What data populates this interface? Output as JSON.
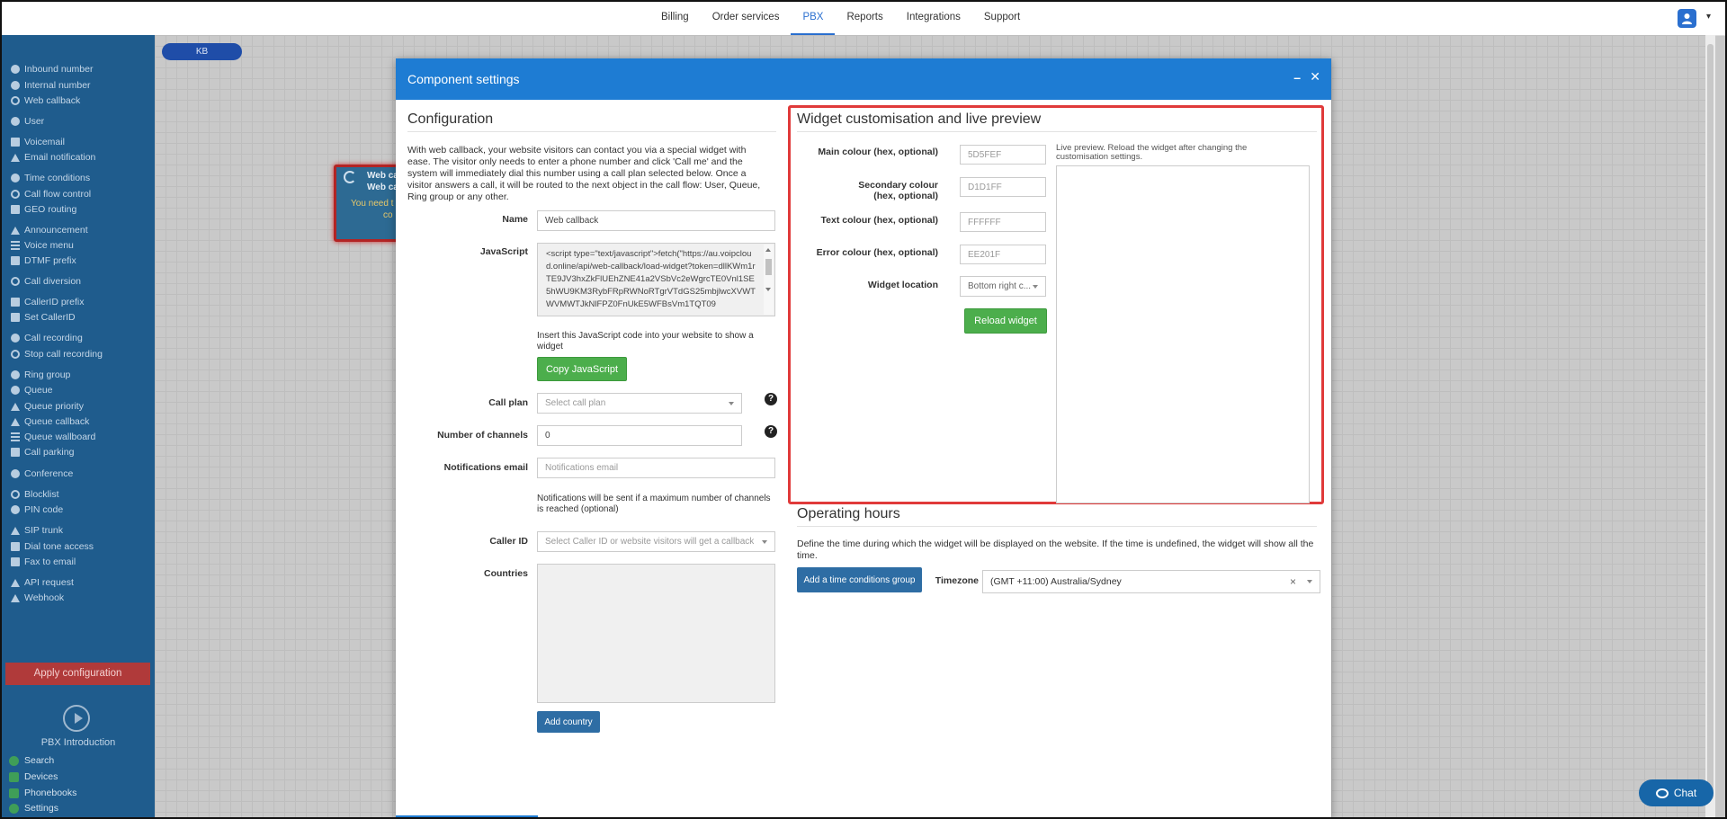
{
  "nav": {
    "tabs": [
      {
        "label": "Billing"
      },
      {
        "label": "Order services"
      },
      {
        "label": "PBX"
      },
      {
        "label": "Reports"
      },
      {
        "label": "Integrations"
      },
      {
        "label": "Support"
      }
    ],
    "active_tab": "PBX"
  },
  "sidebar": {
    "items": [
      {
        "label": "Inbound number",
        "icon": "circle-icon"
      },
      {
        "label": "Internal number",
        "icon": "pin-icon"
      },
      {
        "label": "Web callback",
        "icon": "undo-icon"
      },
      {
        "label": "User",
        "icon": "user-icon"
      },
      {
        "label": "Voicemail",
        "icon": "envelope-icon"
      },
      {
        "label": "Email notification",
        "icon": "bell-icon"
      },
      {
        "label": "Time conditions",
        "icon": "clock-icon"
      },
      {
        "label": "Call flow control",
        "icon": "toggle-icon"
      },
      {
        "label": "GEO routing",
        "icon": "sitemap-icon"
      },
      {
        "label": "Announcement",
        "icon": "megaphone-icon"
      },
      {
        "label": "Voice menu",
        "icon": "menu-icon"
      },
      {
        "label": "DTMF prefix",
        "icon": "code-icon"
      },
      {
        "label": "Call diversion",
        "icon": "redo-icon"
      },
      {
        "label": "CallerID prefix",
        "icon": "id-icon"
      },
      {
        "label": "Set CallerID",
        "icon": "id-card-icon"
      },
      {
        "label": "Call recording",
        "icon": "microphone-icon"
      },
      {
        "label": "Stop call recording",
        "icon": "microphone-slash-icon"
      },
      {
        "label": "Ring group",
        "icon": "users-icon"
      },
      {
        "label": "Queue",
        "icon": "queue-icon"
      },
      {
        "label": "Queue priority",
        "icon": "arrow-up-icon"
      },
      {
        "label": "Queue callback",
        "icon": "reply-icon"
      },
      {
        "label": "Queue wallboard",
        "icon": "dashboard-icon"
      },
      {
        "label": "Call parking",
        "icon": "parking-icon"
      },
      {
        "label": "Conference",
        "icon": "comments-icon"
      },
      {
        "label": "Blocklist",
        "icon": "ban-icon"
      },
      {
        "label": "PIN code",
        "icon": "key-icon"
      },
      {
        "label": "SIP trunk",
        "icon": "plug-icon"
      },
      {
        "label": "Dial tone access",
        "icon": "lock-icon"
      },
      {
        "label": "Fax to email",
        "icon": "fax-icon"
      },
      {
        "label": "API request",
        "icon": "random-icon"
      },
      {
        "label": "Webhook",
        "icon": "paper-plane-icon"
      }
    ],
    "apply_label": "Apply configuration",
    "intro_label": "PBX Introduction",
    "bottom": [
      {
        "label": "Search"
      },
      {
        "label": "Devices"
      },
      {
        "label": "Phonebooks"
      },
      {
        "label": "Settings"
      }
    ]
  },
  "canvas": {
    "kb_label": "KB",
    "node": {
      "line1": "Web ca",
      "line2": "Web ca",
      "warn1": "You need t",
      "warn2": "co"
    }
  },
  "modal": {
    "title": "Component settings",
    "config": {
      "heading": "Configuration",
      "description": "With web callback, your website visitors can contact you via a special widget with ease. The visitor only needs to enter a phone number and click 'Call me' and the system will immediately dial this number using a call plan selected below. Once a visitor answers a call, it will be routed to the next object in the call flow: User, Queue, Ring group or any other.",
      "name_label": "Name",
      "name_value": "Web callback",
      "js_label": "JavaScript",
      "js_code": "<script type=\"text/javascript\">fetch(\"https://au.voipcloud.online/api/web-callback/load-widget?token=dllKWm1rTE9JV3hxZkFlUEhZNE41a2VSbVc2eWgrcTE0Vnl1SE5hWU9KM3RybFRpRWNoRTgrVTdGS25mbjlwcXVWTWVMWTJkNlFPZ0FnUkE5WFBsVm1TQT09",
      "js_hint": "Insert this JavaScript code into your website to show a widget",
      "copy_label": "Copy JavaScript",
      "callplan_label": "Call plan",
      "callplan_placeholder": "Select call plan",
      "channels_label": "Number of channels",
      "channels_value": "0",
      "notif_label": "Notifications email",
      "notif_placeholder": "Notifications email",
      "notif_hint": "Notifications will be sent if a maximum number of channels is reached (optional)",
      "callerid_label": "Caller ID",
      "callerid_placeholder": "Select Caller ID or website visitors will get a callback ...",
      "countries_label": "Countries",
      "add_country_label": "Add country"
    },
    "widget": {
      "heading": "Widget customisation and live preview",
      "main_label": "Main colour (hex, optional)",
      "main_value": "5D5FEF",
      "secondary_label": "Secondary colour (hex, optional)",
      "secondary_value": "D1D1FF",
      "text_label": "Text colour (hex, optional)",
      "text_value": "FFFFFF",
      "error_label": "Error colour (hex, optional)",
      "error_value": "EE201F",
      "location_label": "Widget location",
      "location_value": "Bottom right c...",
      "reload_label": "Reload widget",
      "preview_hint": "Live preview. Reload the widget after changing the customisation settings."
    },
    "hours": {
      "heading": "Operating hours",
      "description": "Define the time during which the widget will be displayed on the website. If the time is undefined, the widget will show all the time.",
      "add_group_label": "Add a time conditions group",
      "timezone_label": "Timezone",
      "timezone_value": "(GMT +11:00) Australia/Sydney",
      "clear_symbol": "×"
    }
  },
  "chat_label": "Chat",
  "colors": {
    "accent": "#1e7cd3",
    "sidebar": "#1f5c8d",
    "success": "#4cae4c",
    "danger": "#e03a3a"
  }
}
